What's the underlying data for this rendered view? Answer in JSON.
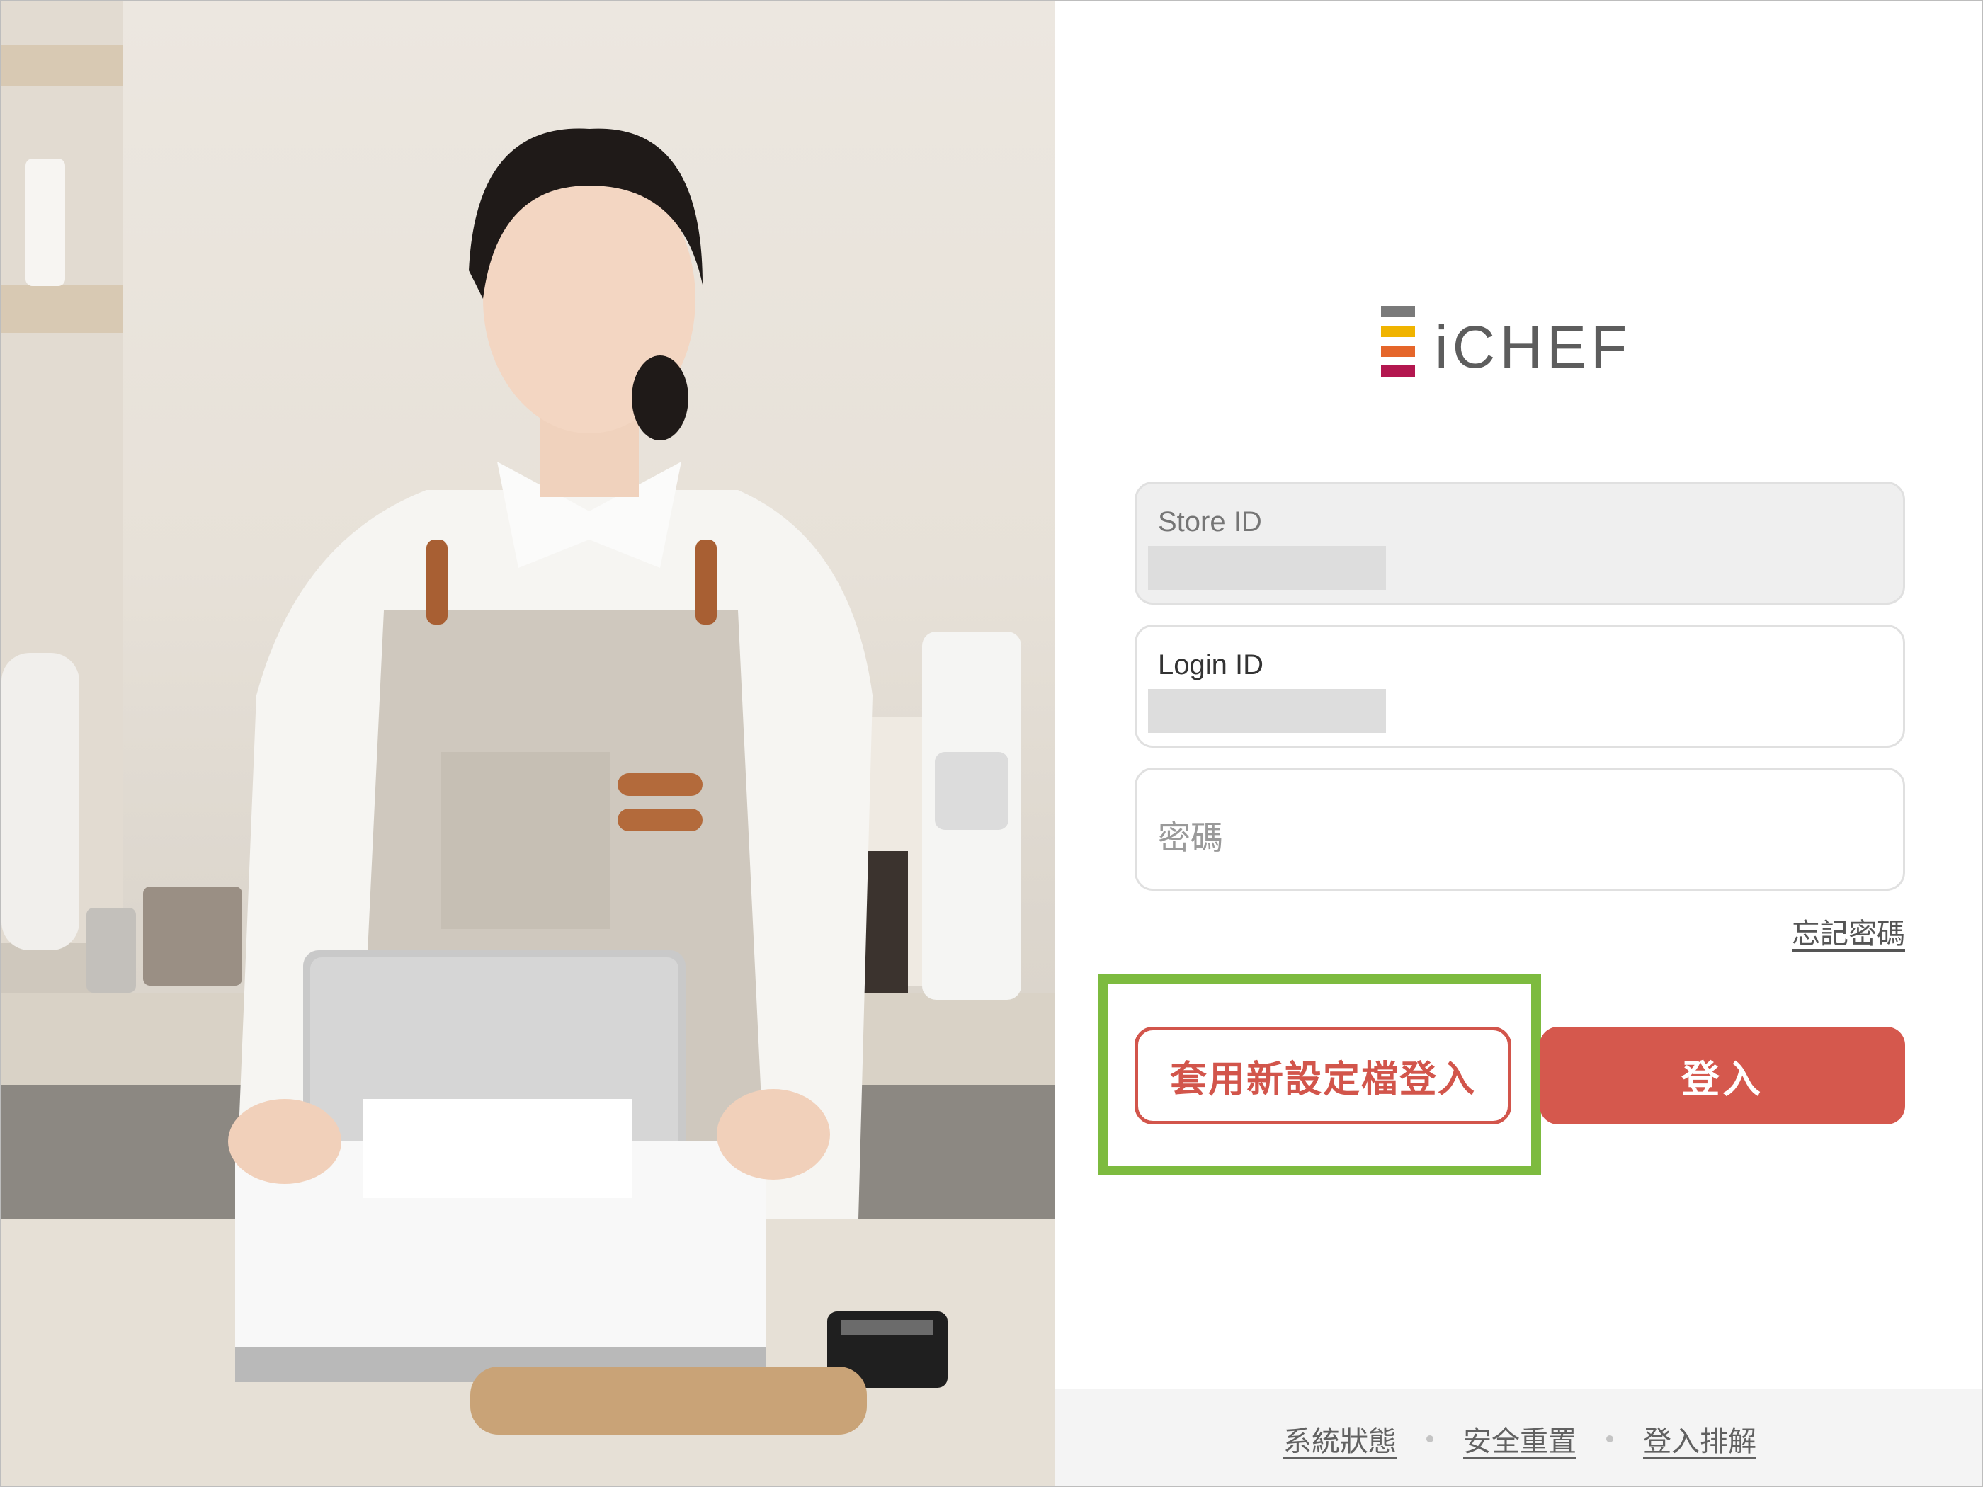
{
  "brand": {
    "name": "iCHEF",
    "logo_colors": [
      "#7a7a7a",
      "#f0b400",
      "#e5662a",
      "#b3174f"
    ]
  },
  "login_form": {
    "store_id_label": "Store ID",
    "login_id_label": "Login ID",
    "password_placeholder": "密碼",
    "forgot_password": "忘記密碼",
    "apply_profile_button": "套用新設定檔登入",
    "login_button": "登入"
  },
  "footer": {
    "links": [
      "系統狀態",
      "安全重置",
      "登入排解"
    ]
  },
  "colors": {
    "accent": "#d5584d",
    "highlight": "#7dbb3f"
  }
}
